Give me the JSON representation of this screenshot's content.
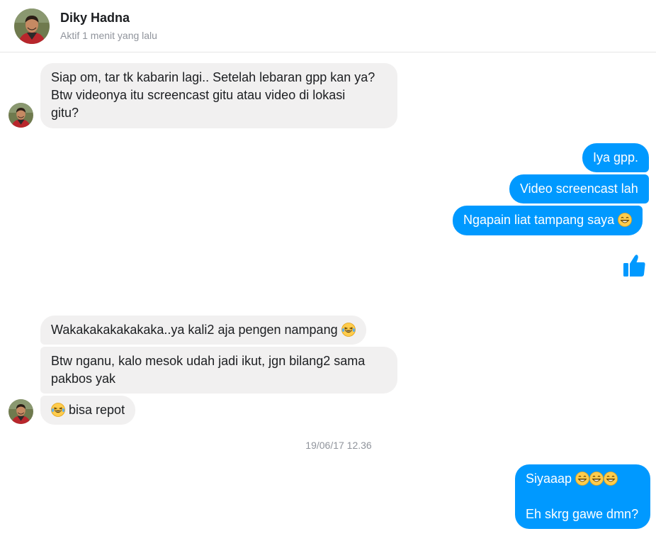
{
  "header": {
    "name": "Diky Hadna",
    "status": "Aktif 1 menit yang lalu"
  },
  "messages": {
    "m1_line1": "Siap om, tar tk kabarin lagi.. Setelah lebaran gpp kan ya?",
    "m1_line2": "Btw videonya itu screencast gitu atau video di lokasi",
    "m1_line3": "gitu?",
    "m2": "Iya gpp.",
    "m3": "Video screencast lah",
    "m4": "Ngapain liat tampang saya",
    "m5": "Wakakakakakakaka..ya kali2 aja pengen nampang",
    "m6_line1": "Btw nganu, kalo mesok udah jadi ikut, jgn bilang2 sama",
    "m6_line2": "pakbos yak",
    "m7": "bisa repot",
    "timestamp": "19/06/17 12.36",
    "m8_line1": "Siyaaap",
    "m8_line3": "Eh skrg gawe dmn?"
  },
  "icons": {
    "like": "thumbs-up-icon",
    "grin": "grinning-face-emoji",
    "laugh": "tears-of-joy-emoji"
  },
  "colors": {
    "outgoing": "#0099ff",
    "incoming": "#f1f0f0"
  }
}
